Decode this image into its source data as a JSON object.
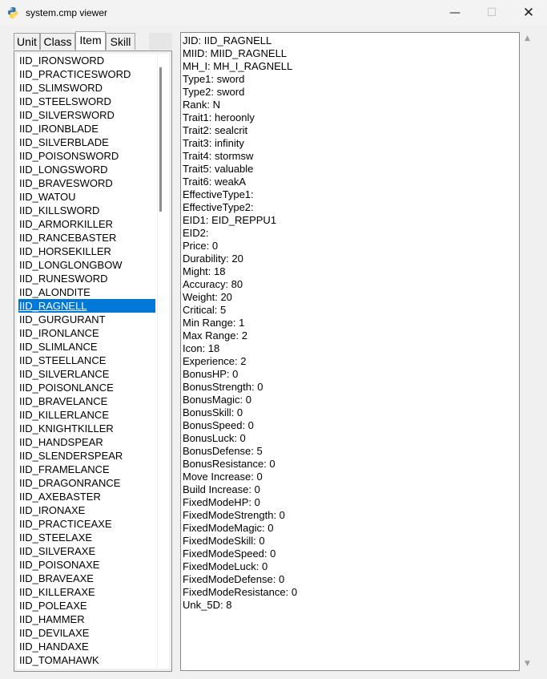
{
  "window": {
    "title": "system.cmp viewer",
    "minimize_glyph": "—",
    "maximize_glyph": "☐",
    "close_glyph": "✕"
  },
  "tabs": [
    "Unit",
    "Class",
    "Item",
    "Skill"
  ],
  "active_tab": 2,
  "items": [
    "IID_IRONSWORD",
    "IID_PRACTICESWORD",
    "IID_SLIMSWORD",
    "IID_STEELSWORD",
    "IID_SILVERSWORD",
    "IID_IRONBLADE",
    "IID_SILVERBLADE",
    "IID_POISONSWORD",
    "IID_LONGSWORD",
    "IID_BRAVESWORD",
    "IID_WATOU",
    "IID_KILLSWORD",
    "IID_ARMORKILLER",
    "IID_RANCEBASTER",
    "IID_HORSEKILLER",
    "IID_LONGLONGBOW",
    "IID_RUNESWORD",
    "IID_ALONDITE",
    "IID_RAGNELL",
    "IID_GURGURANT",
    "IID_IRONLANCE",
    "IID_SLIMLANCE",
    "IID_STEELLANCE",
    "IID_SILVERLANCE",
    "IID_POISONLANCE",
    "IID_BRAVELANCE",
    "IID_KILLERLANCE",
    "IID_KNIGHTKILLER",
    "IID_HANDSPEAR",
    "IID_SLENDERSPEAR",
    "IID_FRAMELANCE",
    "IID_DRAGONRANCE",
    "IID_AXEBASTER",
    "IID_IRONAXE",
    "IID_PRACTICEAXE",
    "IID_STEELAXE",
    "IID_SILVERAXE",
    "IID_POISONAXE",
    "IID_BRAVEAXE",
    "IID_KILLERAXE",
    "IID_POLEAXE",
    "IID_HAMMER",
    "IID_DEVILAXE",
    "IID_HANDAXE",
    "IID_TOMAHAWK"
  ],
  "selected_index": 18,
  "details": [
    "JID: IID_RAGNELL",
    "MIID: MIID_RAGNELL",
    "MH_I: MH_I_RAGNELL",
    "Type1: sword",
    "Type2: sword",
    "Rank: N",
    "Trait1: heroonly",
    "Trait2: sealcrit",
    "Trait3: infinity",
    "Trait4: stormsw",
    "Trait5: valuable",
    "Trait6: weakA",
    "EffectiveType1:",
    "EffectiveType2:",
    "EID1: EID_REPPU1",
    "EID2:",
    "Price: 0",
    "Durability: 20",
    "Might: 18",
    "Accuracy: 80",
    "Weight: 20",
    "Critical: 5",
    "Min Range: 1",
    "Max Range: 2",
    "Icon: 18",
    "Experience: 2",
    "BonusHP: 0",
    "BonusStrength: 0",
    "BonusMagic: 0",
    "BonusSkill: 0",
    "BonusSpeed: 0",
    "BonusLuck: 0",
    "BonusDefense: 5",
    "BonusResistance: 0",
    "Move Increase: 0",
    "Build Increase: 0",
    "FixedModeHP: 0",
    "FixedModeStrength: 0",
    "FixedModeMagic: 0",
    "FixedModeSkill: 0",
    "FixedModeSpeed: 0",
    "FixedModeLuck: 0",
    "FixedModeDefense: 0",
    "FixedModeResistance: 0",
    "Unk_5D: 8"
  ],
  "scroll": {
    "up_glyph": "▲",
    "down_glyph": "▼"
  },
  "colors": {
    "selection": "#0078d7",
    "window_bg": "#f0f0f0",
    "python_blue": "#3776ab",
    "python_yellow": "#ffd43b"
  }
}
